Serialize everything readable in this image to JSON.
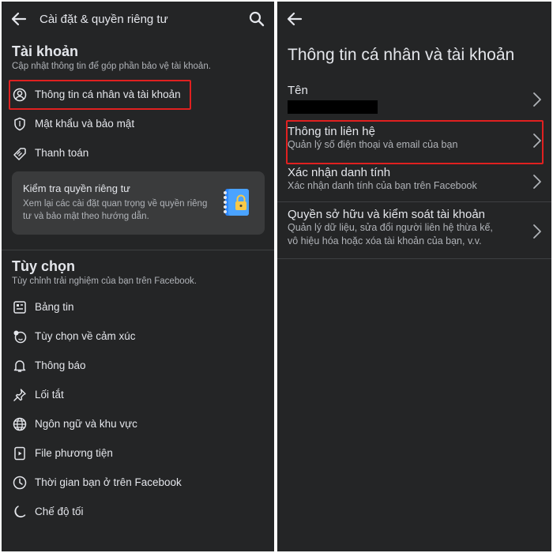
{
  "left": {
    "header": {
      "title": "Cài đặt & quyền riêng tư"
    },
    "account": {
      "title": "Tài khoản",
      "subtitle": "Cập nhật thông tin để góp phần bảo vệ tài khoản.",
      "items": [
        {
          "label": "Thông tin cá nhân và tài khoản",
          "icon": "person-circle-icon",
          "highlighted": true
        },
        {
          "label": "Mật khẩu và bảo mật",
          "icon": "shield-icon"
        },
        {
          "label": "Thanh toán",
          "icon": "tag-icon"
        }
      ]
    },
    "privacy_card": {
      "title": "Kiểm tra quyền riêng tư",
      "desc": "Xem lại các cài đặt quan trọng về quyền riêng tư và bảo mật theo hướng dẫn."
    },
    "preferences": {
      "title": "Tùy chọn",
      "subtitle": "Tùy chỉnh trải nghiệm của bạn trên Facebook.",
      "items": [
        {
          "label": "Bảng tin",
          "icon": "news-feed-icon"
        },
        {
          "label": "Tùy chọn về cảm xúc",
          "icon": "reaction-icon"
        },
        {
          "label": "Thông báo",
          "icon": "bell-icon"
        },
        {
          "label": "Lối tắt",
          "icon": "pin-icon"
        },
        {
          "label": "Ngôn ngữ và khu vực",
          "icon": "globe-icon"
        },
        {
          "label": "File phương tiện",
          "icon": "media-file-icon"
        },
        {
          "label": "Thời gian bạn ở trên Facebook",
          "icon": "clock-icon"
        },
        {
          "label": "Chế độ tối",
          "icon": "moon-icon"
        }
      ]
    }
  },
  "right": {
    "title": "Thông tin cá nhân và tài khoản",
    "items": [
      {
        "label": "Tên",
        "desc": ""
      },
      {
        "label": "Thông tin liên hệ",
        "desc": "Quản lý số điện thoại và email của bạn",
        "highlighted": true
      },
      {
        "label": "Xác nhận danh tính",
        "desc": "Xác nhận danh tính của bạn trên Facebook"
      },
      {
        "label": "Quyền sở hữu và kiểm soát tài khoản",
        "desc_line1": "Quản lý dữ liệu, sửa đổi người liên hệ thừa kế,",
        "desc_line2": "vô hiệu hóa hoặc xóa tài khoản của bạn, v.v."
      }
    ]
  },
  "colors": {
    "background": "#242526",
    "text": "#e4e6eb",
    "secondary_text": "#b0b3b8",
    "highlight": "#e02020",
    "card": "#3a3b3c",
    "accent_blue": "#2d88ff"
  }
}
